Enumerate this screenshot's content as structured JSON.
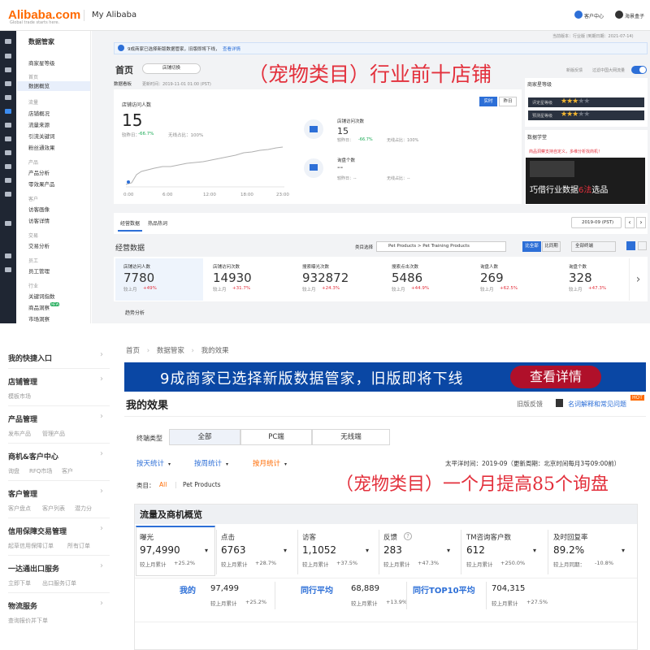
{
  "top": {
    "logo": "Alibaba.com",
    "logo_tagline": "Global trade starts here.",
    "title": "My Alibaba",
    "customer_center": "客户中心",
    "cat_box": "海景盒子"
  },
  "topnav": {
    "groups": [
      {
        "title": "数据管家"
      },
      {
        "item": "商家星等级"
      },
      {
        "group": "首页"
      },
      {
        "item": "数据概览",
        "selected": true
      },
      {
        "group": "流量"
      },
      {
        "item": "店铺概况"
      },
      {
        "item": "流量来源"
      },
      {
        "item": "引流关键词"
      },
      {
        "item": "粉丝通效果"
      },
      {
        "group": "产品"
      },
      {
        "item": "产品分析"
      },
      {
        "item": "零效果产品"
      },
      {
        "group": "客户"
      },
      {
        "item": "访客画像"
      },
      {
        "item": "访客详情"
      },
      {
        "group": "交易"
      },
      {
        "item": "交易分析"
      },
      {
        "group": "员工"
      },
      {
        "item": "员工管理"
      },
      {
        "group": "行业"
      },
      {
        "item": "关键词指数"
      },
      {
        "item": "商品洞察",
        "badge": "NEW"
      },
      {
        "item": "市场洞察"
      }
    ]
  },
  "dash": {
    "notice": "9成商家已选择新版数据管家，旧版即将下线，",
    "notice_link": "查看详情",
    "version_text": "当前版本：行业版 (到期日期：2021-07-14)",
    "page_title": "首页",
    "shop_switch": "店铺切换",
    "overlay_title": "（宠物类目）行业前十店铺",
    "new_feedback": "新版反馈",
    "filter_toggle": "过滤中国大网流量",
    "board": "数据看板",
    "updated": "更新时间：2019-11-01 01:00 (PST)",
    "toggle_realtime": "实时",
    "toggle_yesterday": "昨日",
    "visitors_label": "店铺访问人数",
    "visitors_value": "15",
    "visitors_day": "较昨日：",
    "visitors_day_val": "-66.7%",
    "visitors_wireless": "无线占比：100%",
    "visits_label": "店铺访问次数",
    "visits_value": "15",
    "visits_day": "较昨日：",
    "visits_day_val": "-66.7%",
    "visits_wireless": "无线占比：100%",
    "inq_label": "询盘个数",
    "inq_value": "--",
    "inq_day": "较昨日：--",
    "inq_wireless": "无线占比：--",
    "x_ticks": [
      "0:00",
      "6:00",
      "12:00",
      "18:00",
      "23:00"
    ],
    "star_title": "商家星等级",
    "star_rating": "评定星等级",
    "star_forecast": "预测星等级",
    "learn": "数据学堂",
    "learn_notice": "商品洞察支持自定义，多维分析找商机！",
    "promo": "巧借行业数据",
    "promo_red": "6法",
    "promo_tail": "选品",
    "tab_biz": "经营数据",
    "tab_hot": "热品热词",
    "period": "2019-09 (PST)",
    "biz_title": "经营数据",
    "cat_label": "类目选择",
    "cat_value": "Pet Products > Pet Training Products",
    "btn_compare": "比全部",
    "btn_peer": "比同期",
    "terminal": "全部终端",
    "trend": "趋势分析",
    "metrics": [
      {
        "label": "店铺访问人数",
        "value": "7780",
        "cmp": "较上月",
        "pct": "+49%"
      },
      {
        "label": "店铺访问次数",
        "value": "14930",
        "cmp": "较上月",
        "pct": "+31.7%"
      },
      {
        "label": "搜索曝光次数",
        "value": "932872",
        "cmp": "较上月",
        "pct": "+24.3%"
      },
      {
        "label": "搜索点击次数",
        "value": "5486",
        "cmp": "较上月",
        "pct": "+44.9%"
      },
      {
        "label": "询盘人数",
        "value": "269",
        "cmp": "较上月",
        "pct": "+62.5%"
      },
      {
        "label": "询盘个数",
        "value": "328",
        "cmp": "较上月",
        "pct": "+47.3%"
      }
    ]
  },
  "left": {
    "groups": [
      {
        "title": "我的快捷入口",
        "subs": []
      },
      {
        "title": "店铺管理",
        "subs": [
          "模板市场"
        ]
      },
      {
        "title": "产品管理",
        "subs": [
          "发布产品",
          "管理产品"
        ]
      },
      {
        "title": "商机&客户中心",
        "subs": [
          "询盘",
          "RFQ市场",
          "客户"
        ]
      },
      {
        "title": "客户管理",
        "subs": [
          "客户盘点",
          "客户列表",
          "潜力分"
        ]
      },
      {
        "title": "信用保障交易管理",
        "subs": [
          "起草信用保障订单",
          "所有订单"
        ]
      },
      {
        "title": "一达通出口服务",
        "subs": [
          "立即下单",
          "出口服务订单"
        ]
      },
      {
        "title": "物流服务",
        "subs": [
          "查询报价并下单"
        ]
      }
    ]
  },
  "effect": {
    "breadcrumb": [
      "首页",
      "数据管家",
      "我的效果"
    ],
    "banner_text": "9成商家已选择新版数据管家，旧版即将下线",
    "banner_btn": "查看详情",
    "title": "我的效果",
    "old_feedback": "旧版反馈",
    "help": "名词解释和常见问题",
    "hot": "HOT",
    "terminal_label": "终端类型",
    "tabs": [
      "全部",
      "PC端",
      "无线端"
    ],
    "stat_day": "按天统计",
    "stat_week": "按周统计",
    "stat_month": "按月统计",
    "time_info": "太平洋时间：2019-09（更新周期：北京时间每月3号09:00前）",
    "category_label": "类目：",
    "cat_all": "All",
    "cat_pet": "Pet Products",
    "overlay": "（宠物类目）一个月提高85个询盘",
    "panel_title": "流量及商机概览",
    "metrics": [
      {
        "label": "曝光",
        "value": "97,4990",
        "cmp": "较上月累计",
        "pct": "+25.2%",
        "pct_color": "red"
      },
      {
        "label": "点击",
        "value": "6763",
        "cmp": "较上月累计",
        "pct": "+28.7%",
        "pct_color": "red"
      },
      {
        "label": "访客",
        "value": "1,1052",
        "cmp": "较上月累计",
        "pct": "+37.5%",
        "pct_color": "red"
      },
      {
        "label": "反馈",
        "value": "283",
        "cmp": "较上月累计",
        "pct": "+47.3%",
        "pct_color": "red"
      },
      {
        "label": "TM咨询客户数",
        "value": "612",
        "cmp": "较上月累计",
        "pct": "+250.0%",
        "pct_color": "red"
      },
      {
        "label": "及时回复率",
        "value": "89.2%",
        "cmp": "较上月同期：",
        "pct": "-10.8%",
        "pct_color": "green"
      }
    ],
    "compare": {
      "mine_label": "我的",
      "mine_value": "97,499",
      "mine_cmp": "较上月累计",
      "mine_pct": "+25.2%",
      "peer_label": "同行平均",
      "peer_value": "68,889",
      "peer_cmp": "较上月累计",
      "peer_pct": "+13.9%",
      "top_label": "同行TOP10平均",
      "top_value": "704,315",
      "top_cmp": "较上月累计",
      "top_pct": "+27.5%"
    }
  },
  "colors": {
    "orange": "#ff6a00",
    "red": "#e3303c",
    "blue": "#2d6fd7",
    "navy": "#0a47a4",
    "green": "#1aaa55"
  },
  "icons": [
    "store-icon",
    "mail-icon",
    "chevron-right-icon",
    "chevron-down-icon",
    "star-icon",
    "help-icon",
    "book-icon"
  ]
}
